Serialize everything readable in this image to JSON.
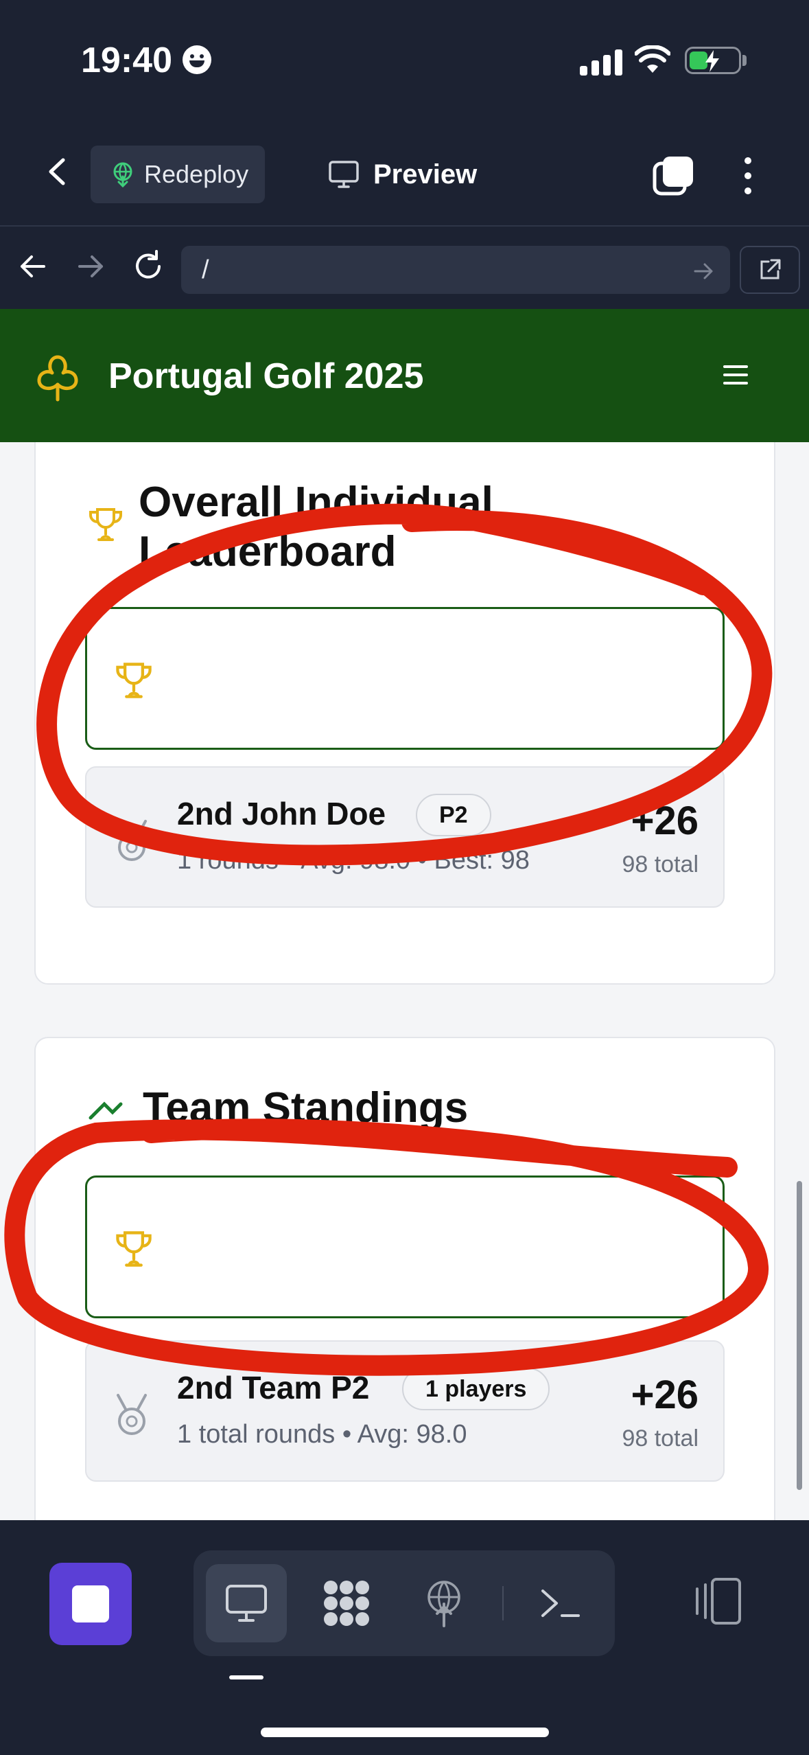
{
  "status_bar": {
    "time": "19:40"
  },
  "app_header": {
    "redeploy_label": "Redeploy",
    "preview_label": "Preview"
  },
  "browser": {
    "url": "/"
  },
  "site": {
    "title": "Portugal Golf 2025"
  },
  "individual": {
    "title_line1": "Overall Individual",
    "title_line2": "Leaderboard",
    "second": {
      "rank_name": "2nd  John Doe",
      "badge": "P2",
      "stats": "1 rounds • Avg: 98.0 • Best: 98",
      "score": "+26",
      "total": "98 total"
    }
  },
  "team": {
    "title": "Team Standings",
    "second": {
      "rank_name": "2nd  Team P2",
      "badge": "1 players",
      "stats": "1 total rounds • Avg: 98.0",
      "score": "+26",
      "total": "98 total"
    }
  },
  "colors": {
    "app_bg": "#1c2232",
    "site_green": "#155012",
    "trophy_gold": "#e7b417",
    "annotation_red": "#e0230e",
    "stop_purple": "#5b3fd6"
  }
}
